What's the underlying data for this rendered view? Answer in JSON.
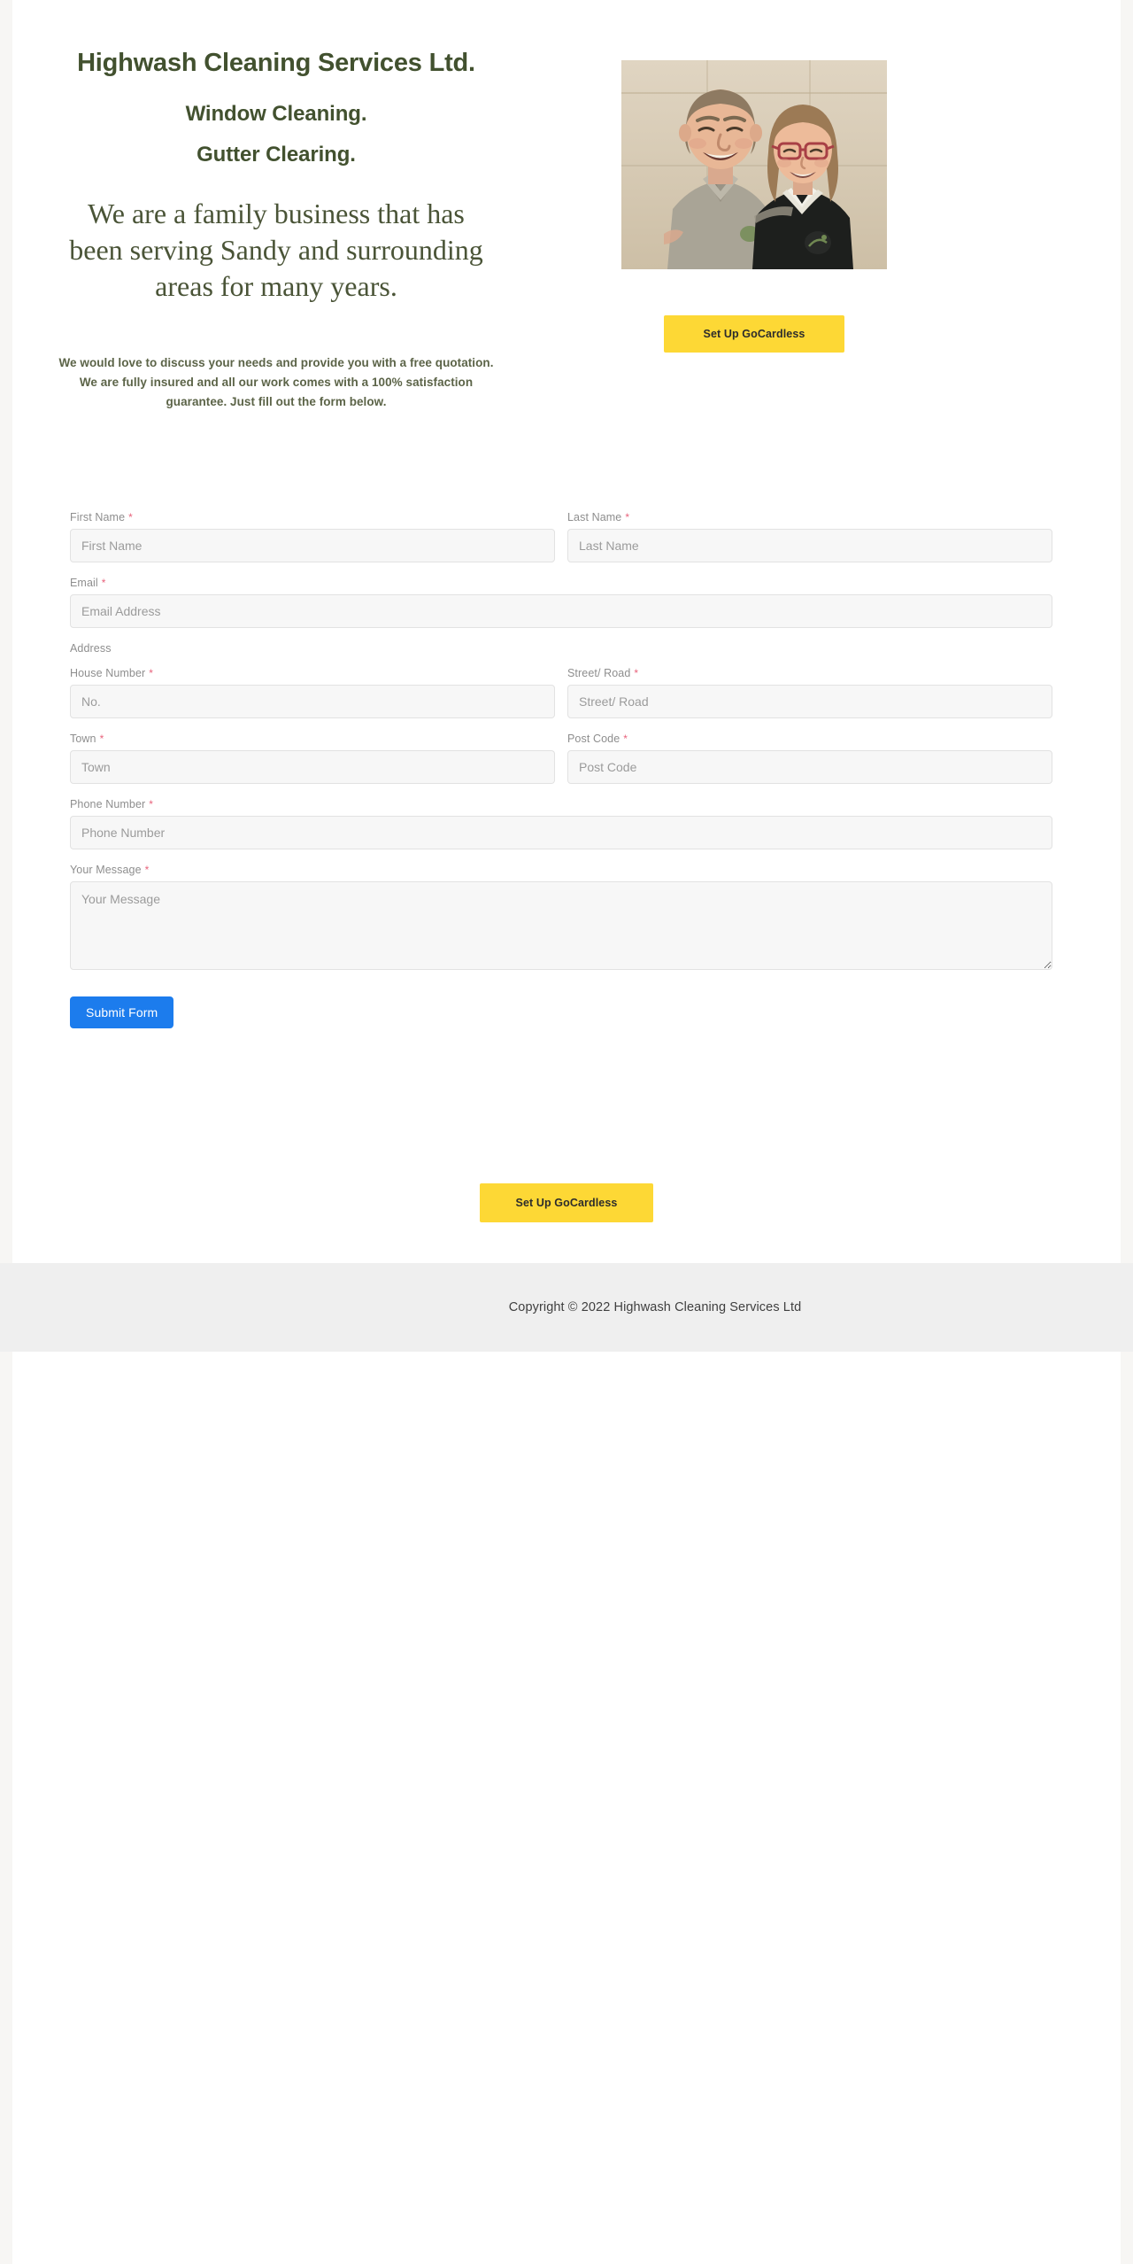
{
  "site": {
    "background_color": "#ffffff",
    "heading_color": "#42512f",
    "accent_yellow": "#fdd835",
    "accent_blue": "#1c7ced",
    "required_color": "#e8637c",
    "footer_background": "#efefef"
  },
  "hero": {
    "title": "Highwash Cleaning Services Ltd.",
    "subtitle_1": "Window Cleaning.",
    "subtitle_2": "Gutter Clearing.",
    "intro": "We are a family business that has been serving Sandy and surrounding areas for many years.",
    "note": "We would love to discuss your needs and provide you with a free quotation.  We are fully insured and all our work comes with a 100% satisfaction guarantee. Just fill out the form below.",
    "photo_alt": "Photograph of a smiling man and woman in company polo shirt and jumper",
    "cta_label": "Set Up GoCardless"
  },
  "form": {
    "address_section_label": "Address",
    "submit_label": "Submit Form",
    "required_marker": "*",
    "fields": {
      "first_name": {
        "label": "First Name",
        "placeholder": "First Name",
        "value": "",
        "required": true
      },
      "last_name": {
        "label": "Last Name",
        "placeholder": "Last Name",
        "value": "",
        "required": true
      },
      "email": {
        "label": "Email",
        "placeholder": "Email Address",
        "value": "",
        "required": true
      },
      "house_number": {
        "label": "House Number",
        "placeholder": "No.",
        "value": "",
        "required": true
      },
      "street": {
        "label": "Street/ Road",
        "placeholder": "Street/ Road",
        "value": "",
        "required": true
      },
      "town": {
        "label": "Town",
        "placeholder": "Town",
        "value": "",
        "required": true
      },
      "post_code": {
        "label": "Post Code",
        "placeholder": "Post Code",
        "value": "",
        "required": true
      },
      "phone": {
        "label": "Phone Number",
        "placeholder": "Phone Number",
        "value": "",
        "required": true
      },
      "message": {
        "label": "Your Message",
        "placeholder": "Your Message",
        "value": "",
        "required": true
      }
    }
  },
  "bottom_cta": {
    "label": "Set Up GoCardless"
  },
  "footer": {
    "copyright": "Copyright © 2022 Highwash Cleaning Services Ltd"
  }
}
